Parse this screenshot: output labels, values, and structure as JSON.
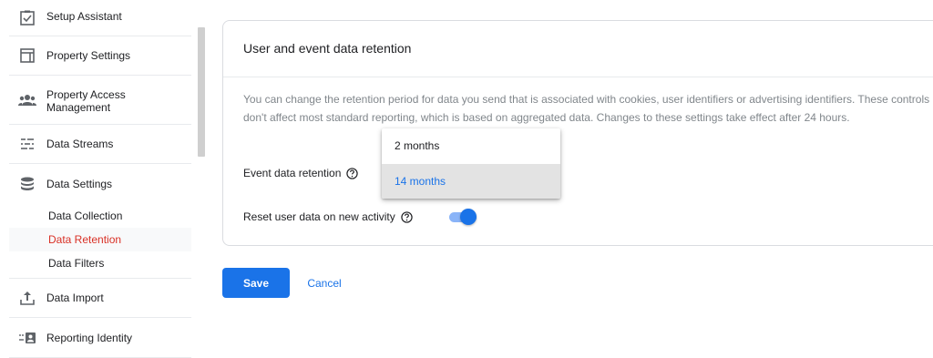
{
  "sidebar": {
    "items": [
      {
        "label": "Setup Assistant",
        "icon": "checkbox-icon"
      },
      {
        "label": "Property Settings",
        "icon": "layout-icon"
      },
      {
        "label": "Property Access\nManagement",
        "icon": "people-icon"
      },
      {
        "label": "Data Streams",
        "icon": "streams-icon"
      },
      {
        "label": "Data Settings",
        "icon": "database-icon"
      },
      {
        "label": "Data Import",
        "icon": "upload-icon"
      },
      {
        "label": "Reporting Identity",
        "icon": "identity-icon"
      }
    ],
    "subitems": [
      {
        "label": "Data Collection"
      },
      {
        "label": "Data Retention",
        "active": true
      },
      {
        "label": "Data Filters"
      }
    ]
  },
  "card": {
    "title": "User and event data retention",
    "description": "You can change the retention period for data you send that is associated with cookies, user identifiers or advertising identifiers. These controls don't affect most standard reporting, which is based on aggregated data. Changes to these settings take effect after 24 hours.",
    "event_retention_label": "Event data retention",
    "reset_label": "Reset user data on new activity",
    "reset_enabled": true
  },
  "dropdown": {
    "options": [
      "2 months",
      "14 months"
    ],
    "selected": "14 months"
  },
  "actions": {
    "save_label": "Save",
    "cancel_label": "Cancel"
  },
  "colors": {
    "accent": "#1a73e8",
    "active_nav": "#d93025"
  }
}
